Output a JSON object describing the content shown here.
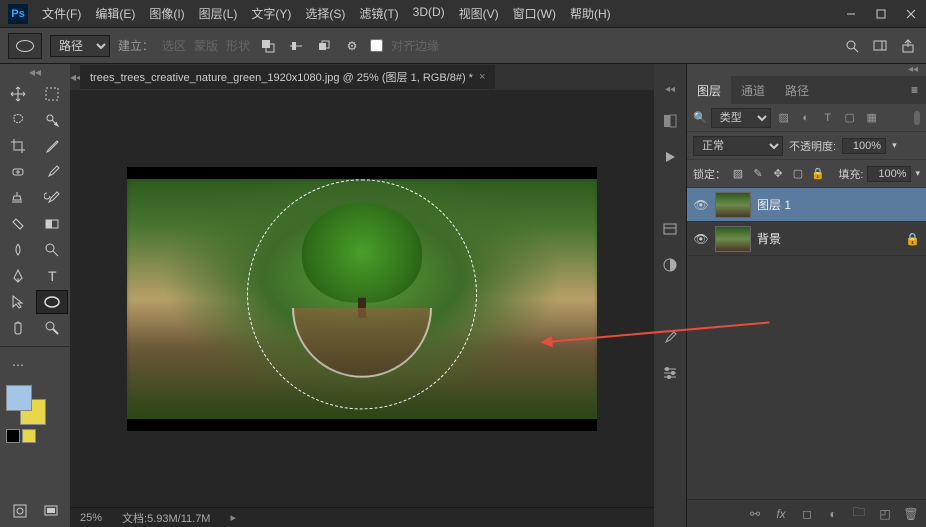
{
  "app": {
    "logo": "Ps"
  },
  "menu": [
    "文件(F)",
    "编辑(E)",
    "图像(I)",
    "图层(L)",
    "文字(Y)",
    "选择(S)",
    "滤镜(T)",
    "3D(D)",
    "视图(V)",
    "窗口(W)",
    "帮助(H)"
  ],
  "optbar": {
    "mode": "路径",
    "build": "建立：",
    "sel": "选区",
    "mask": "蒙版",
    "shape": "形状",
    "align": "对齐边缘"
  },
  "doc": {
    "tab": "trees_trees_creative_nature_green_1920x1080.jpg @ 25% (图层 1, RGB/8#) *"
  },
  "status": {
    "zoom": "25%",
    "docinfo": "文档:5.93M/11.7M"
  },
  "panels": {
    "tabs": [
      "图层",
      "通道",
      "路径"
    ],
    "filter_label": "类型",
    "blend_mode": "正常",
    "opacity_label": "不透明度:",
    "opacity_val": "100%",
    "lock_label": "锁定：",
    "fill_label": "填充:",
    "fill_val": "100%",
    "layers": [
      {
        "name": "图层 1",
        "selected": true,
        "locked": false
      },
      {
        "name": "背景",
        "selected": false,
        "locked": true
      }
    ]
  }
}
